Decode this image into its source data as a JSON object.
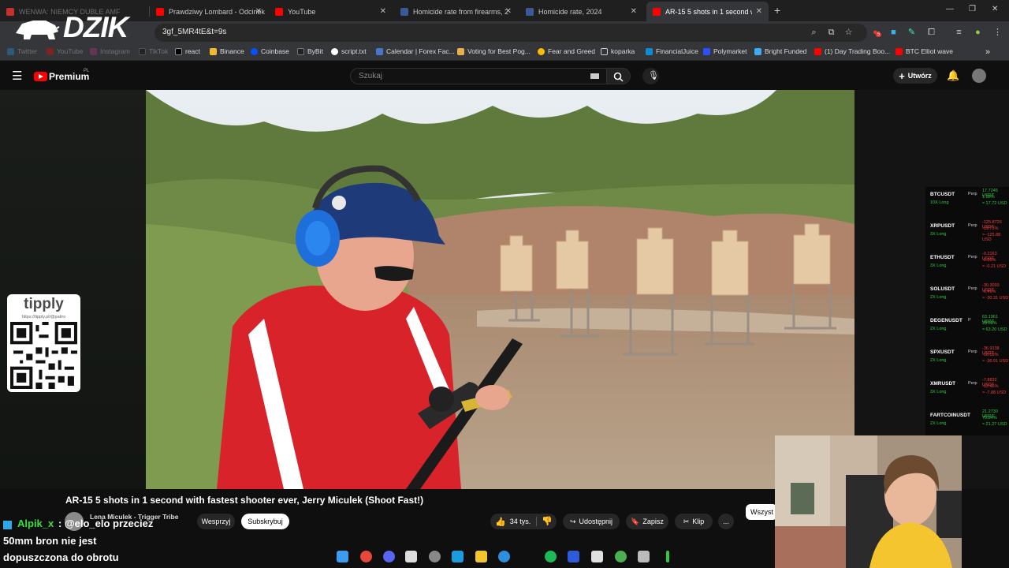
{
  "browser": {
    "tabs": [
      {
        "label": "WENWA: NIEMCY DUBLE AMF",
        "color": "#c4302b",
        "active": false
      },
      {
        "label": "Prawdziwy Lombard - Odcinek",
        "color": "#ff0000",
        "active": false
      },
      {
        "label": "YouTube",
        "color": "#ff0000",
        "active": false
      },
      {
        "label": "Homicide rate from firearms, 2",
        "color": "#3b5998",
        "active": false
      },
      {
        "label": "Homicide rate, 2024",
        "color": "#3b5998",
        "active": false
      },
      {
        "label": "AR-15 5 shots in 1 second with",
        "color": "#ff0000",
        "active": true
      }
    ],
    "new_tab": "+",
    "url": "3gf_5MR4tE&t=9s",
    "bookmarks": [
      "Twitter",
      "YouTube",
      "Instagram",
      "TikTok",
      "react",
      "Binance",
      "Coinbase",
      "ByBit",
      "script.txt",
      "Calendar | Forex Fac...",
      "Voting for Best Pog...",
      "Fear and Greed",
      "koparka",
      "FinancialJuice",
      "Polymarket",
      "Bright Funded",
      "(1) Day Trading Boo...",
      "BTC Elliot wave"
    ],
    "extension_badge": "5"
  },
  "overlay": {
    "logo": "DZIK",
    "tippy": {
      "brand": "tipply",
      "url": "https://tipply.pl/@patiro"
    }
  },
  "youtube": {
    "brand": "Premium",
    "region": "PL",
    "search_placeholder": "Szukaj",
    "create_label": "Utwórz",
    "video_title": "AR-15 5 shots in 1 second with fastest shooter ever, Jerry Miculek (Shoot Fast!)",
    "channel": "Lena Miculek - Trigger Tribe",
    "support_label": "Wesprzyj",
    "subscribe_label": "Subskrybuj",
    "likes": "34 tys.",
    "share_label": "Udostępnij",
    "save_label": "Zapisz",
    "clip_label": "Klip",
    "more_label": "...",
    "chip_label": "Wszyst"
  },
  "crypto_positions": [
    {
      "sym": "BTCUSDT",
      "tag": "Perp",
      "lev": "10X Long",
      "v1": "17.7245 USDT",
      "v2": "1.58%",
      "v3": "≈ 17.72 USD",
      "up": true
    },
    {
      "sym": "XRPUSDT",
      "tag": "Perp",
      "lev": "3X Long",
      "v1": "-125.8726 USDT",
      "v2": "-19.73%",
      "v3": "≈ -125.88 USD",
      "up": false
    },
    {
      "sym": "ETHUSDT",
      "tag": "Perp",
      "lev": "3X Long",
      "v1": "-0.2163 USDT",
      "v2": "-0.03%",
      "v3": "≈ -0.21 USD",
      "up": false
    },
    {
      "sym": "SOLUSDT",
      "tag": "Perp",
      "lev": "2X Long",
      "v1": "-30.3093 USDT",
      "v2": "-6.49%",
      "v3": "≈ -30.31 USD",
      "up": false
    },
    {
      "sym": "DEGENUSDT",
      "tag": "P",
      "lev": "2X Long",
      "v1": "63.1961 USDT",
      "v2": "28.68%",
      "v3": "≈ 63.20 USD",
      "up": true
    },
    {
      "sym": "SPXUSDT",
      "tag": "Perp",
      "lev": "2X Long",
      "v1": "-36.9138 USDT",
      "v2": "-18.09%",
      "v3": "≈ -36.91 USD",
      "up": false
    },
    {
      "sym": "XMRUSDT",
      "tag": "Perp",
      "lev": "3X Long",
      "v1": "-7.8832 USDT",
      "v2": "-12.46%",
      "v3": "≈ -7.88 USD",
      "up": false
    },
    {
      "sym": "FARTCOINUSDT",
      "tag": "",
      "lev": "2X Long",
      "v1": "21.2730 USDT",
      "v2": "70.84%",
      "v3": "≈ 21.27 USD",
      "up": true
    }
  ],
  "chat": {
    "user": "Alpik_x",
    "mention": ": @elo_elo przeciez",
    "line2": "50mm bron nie jest",
    "line3": "dopuszczona do obrotu"
  },
  "colors": {
    "accent": "#ff0000",
    "positive": "#2ecc40",
    "negative": "#ff3b3b"
  }
}
